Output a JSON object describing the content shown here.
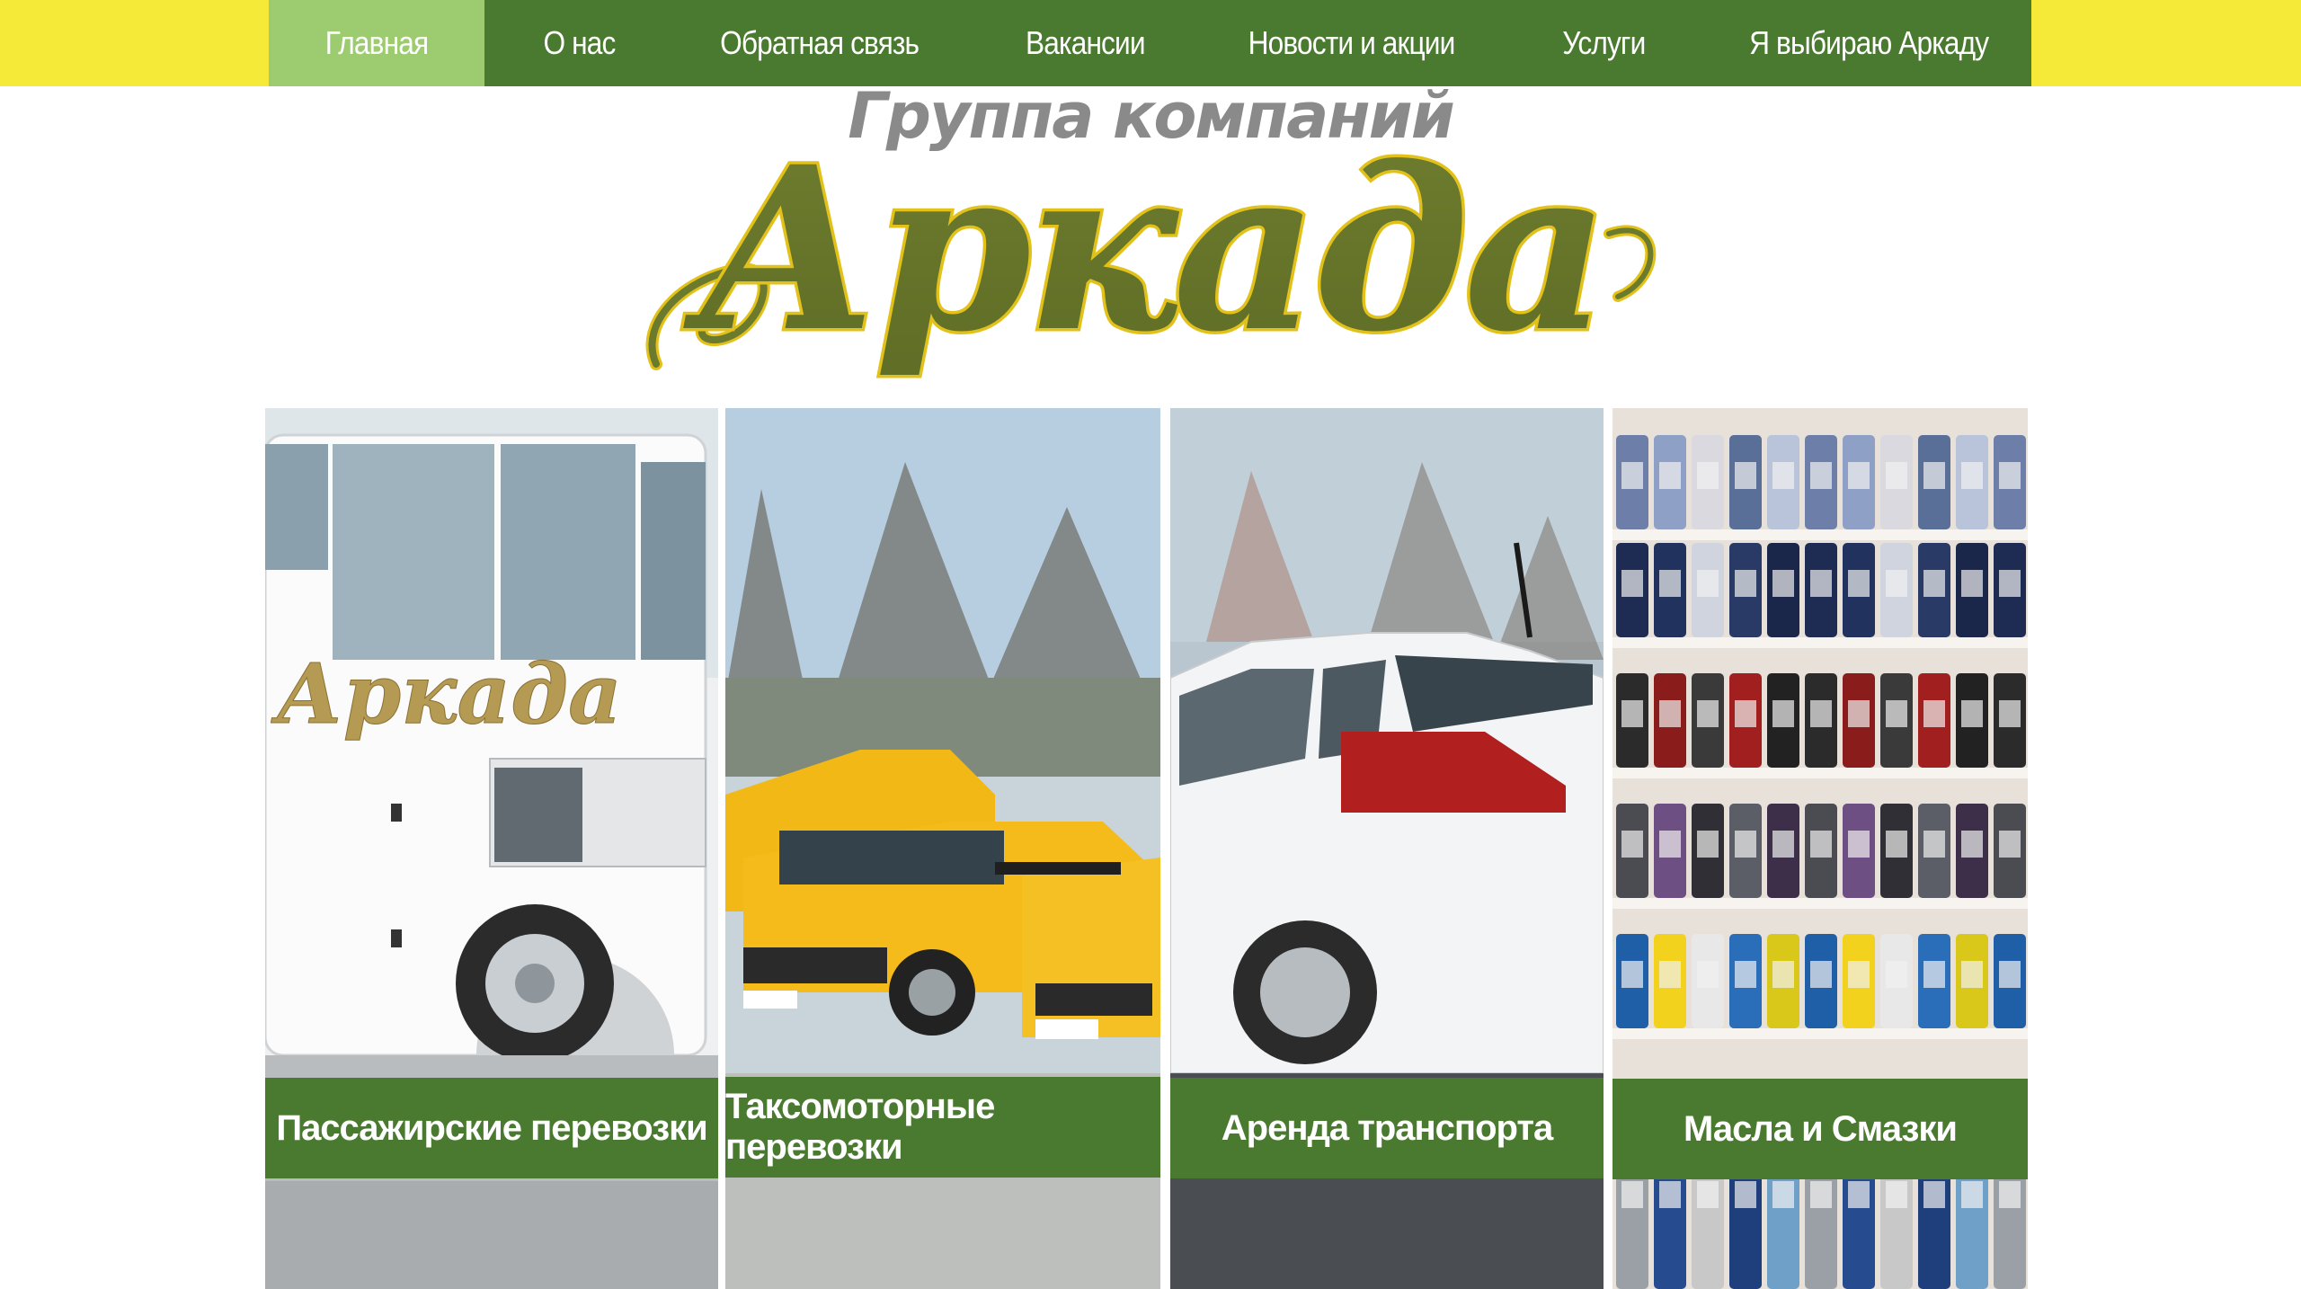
{
  "nav": {
    "items": [
      {
        "label": "Главная",
        "active": true
      },
      {
        "label": "О нас",
        "active": false
      },
      {
        "label": "Обратная связь",
        "active": false
      },
      {
        "label": "Вакансии",
        "active": false
      },
      {
        "label": "Новости и акции",
        "active": false
      },
      {
        "label": "Услуги",
        "active": false
      },
      {
        "label": "Я выбираю Аркаду",
        "active": false
      }
    ]
  },
  "header": {
    "subtitle": "Группа компаний",
    "logo_text": "Аркада"
  },
  "services": [
    {
      "label": "Пассажирские  перевозки",
      "bus_logo_text": "Аркада"
    },
    {
      "label": "Таксомоторные  перевозки"
    },
    {
      "label": "Аренда транспорта"
    },
    {
      "label": "Масла и Смазки"
    }
  ],
  "colors": {
    "yellow": "#f4ea37",
    "nav_green": "#4a7a2f",
    "nav_active": "#9ccc6f",
    "logo_olive": "#6b7a2c",
    "logo_outline": "#e2c21a",
    "subtitle_grey": "#8a8a8a"
  }
}
